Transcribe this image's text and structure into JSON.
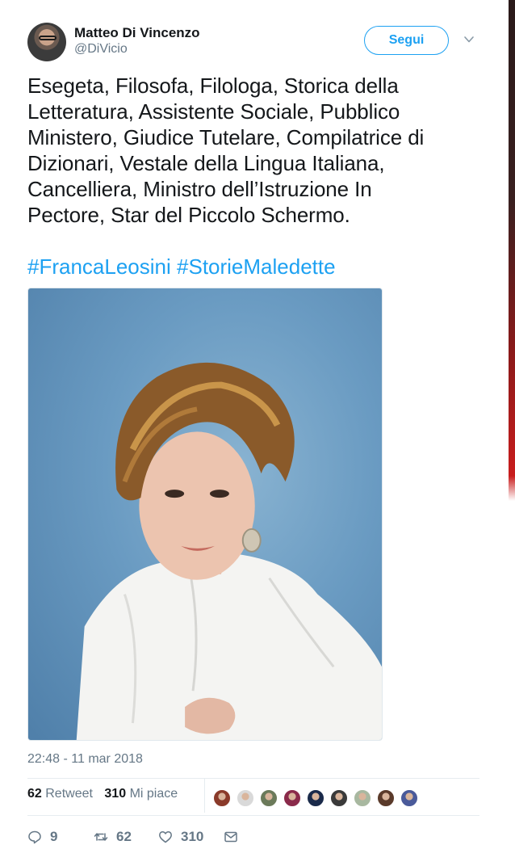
{
  "author": {
    "name": "Matteo Di Vincenzo",
    "handle": "@DiVicio"
  },
  "follow_button": {
    "label": "Segui"
  },
  "tweet": {
    "text_lines": [
      "Esegeta, Filosofa, Filologa, Storica della",
      "Letteratura, Assistente Sociale, Pubblico",
      "Ministero, Giudice Tutelare, Compilatrice di",
      "Dizionari, Vestale della Lingua Italiana,",
      "Cancelliera, Ministro dell’Istruzione In",
      "Pectore, Star del Piccolo Schermo."
    ],
    "hashtags": [
      "#FrancaLeosini",
      "#StorieMaledette"
    ],
    "timestamp": "22:48 - 11 mar 2018"
  },
  "stats": {
    "retweets_count": "62",
    "retweets_label": "Retweet",
    "likes_count": "310",
    "likes_label": "Mi piace"
  },
  "likers": [
    "#8a3a2a",
    "#d9d9d9",
    "#6b7a5a",
    "#8a2a4a",
    "#1a2a4a",
    "#3a3a3a",
    "#a8b8a0",
    "#5a3a2a",
    "#4a5a9a"
  ],
  "actions": {
    "reply_count": "9",
    "retweet_count": "62",
    "like_count": "310"
  },
  "colors": {
    "accent": "#1da1f2",
    "muted": "#657786",
    "text": "#14171a"
  },
  "icons": [
    "chevron-down-icon",
    "reply-icon",
    "retweet-icon",
    "heart-icon",
    "message-icon"
  ]
}
